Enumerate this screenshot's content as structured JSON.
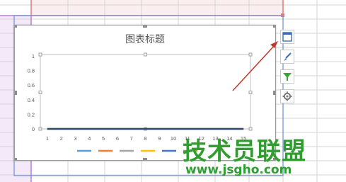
{
  "spreadsheet": {
    "colors": {
      "gridline": "#d4d4d4",
      "selection_top": "#e07b7b",
      "selection_left": "#b77bd6",
      "selection_fill_top": "#fbeeee",
      "selection_fill_left": "#f3e9f8",
      "selection_blue": "#6c8ed6"
    }
  },
  "chart": {
    "title": "图表标题",
    "series_colors": [
      "#5b9bd5",
      "#ed7d31",
      "#a5a5a5",
      "#ffc000",
      "#4472c4",
      "#70ad47"
    ]
  },
  "chart_data": {
    "type": "line",
    "title": "图表标题",
    "x": [
      1,
      2,
      3,
      4,
      5,
      6,
      7,
      8,
      9,
      10,
      11,
      12,
      13,
      14,
      15
    ],
    "x_tick_labels": [
      "1",
      "2",
      "3",
      "4",
      "5",
      "6",
      "7",
      "8",
      "9",
      "10",
      "11",
      "12",
      "13",
      "14",
      "15"
    ],
    "y_tick_labels": [
      "0",
      "0.2",
      "0.4",
      "0.6",
      "0.8",
      "1"
    ],
    "ylim": [
      0,
      1
    ],
    "series": [
      {
        "values": [
          0,
          0,
          0,
          0,
          0,
          0,
          0,
          0,
          0,
          0,
          0,
          0,
          0,
          0,
          0
        ]
      },
      {
        "values": [
          0,
          0,
          0,
          0,
          0,
          0,
          0,
          0,
          0,
          0,
          0,
          0,
          0,
          0,
          0
        ]
      },
      {
        "values": [
          0,
          0,
          0,
          0,
          0,
          0,
          0,
          0,
          0,
          0,
          0,
          0,
          0,
          0,
          0
        ]
      },
      {
        "values": [
          0,
          0,
          0,
          0,
          0,
          0,
          0,
          0,
          0,
          0,
          0,
          0,
          0,
          0,
          0
        ]
      },
      {
        "values": [
          0,
          0,
          0,
          0,
          0,
          0,
          0,
          0,
          0,
          0,
          0,
          0,
          0,
          0,
          0
        ]
      },
      {
        "values": [
          0,
          0,
          0,
          0,
          0,
          0,
          0,
          0,
          0,
          0,
          0,
          0,
          0,
          0,
          0
        ]
      }
    ],
    "grid": false,
    "legend": "bottom"
  },
  "side_toolbar": [
    {
      "icon": "chart-elements-icon"
    },
    {
      "icon": "chart-styles-brush-icon"
    },
    {
      "icon": "chart-filter-icon"
    },
    {
      "icon": "chart-settings-gear-icon"
    }
  ],
  "annotation": {
    "arrow_color": "#c0392b"
  },
  "watermark": {
    "title": "技术员联盟",
    "url": "www.jsgho.com"
  }
}
